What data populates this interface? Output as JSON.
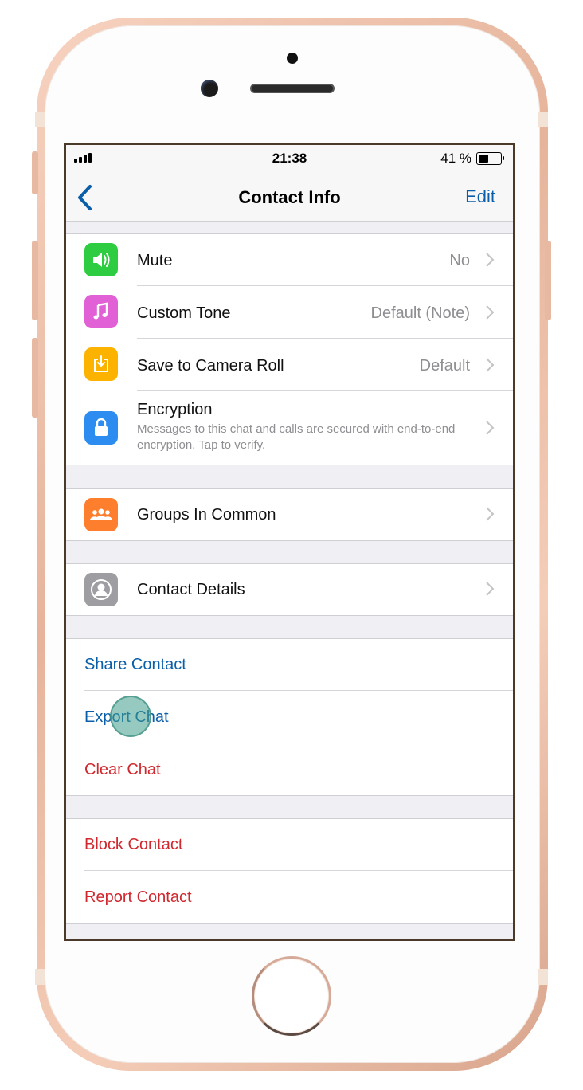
{
  "status_bar": {
    "time": "21:38",
    "battery_percent": "41 %",
    "battery_level": 0.41,
    "signal_bars": 4
  },
  "nav": {
    "back_icon": "chevron-left-icon",
    "title": "Contact Info",
    "edit_label": "Edit"
  },
  "settings": {
    "mute": {
      "label": "Mute",
      "value": "No",
      "icon": "speaker-icon",
      "color": "#2ecc40"
    },
    "custom_tone": {
      "label": "Custom Tone",
      "value": "Default (Note)",
      "icon": "music-note-icon",
      "color": "#e260d5"
    },
    "save_camera_roll": {
      "label": "Save to Camera Roll",
      "value": "Default",
      "icon": "download-icon",
      "color": "#fcb300"
    },
    "encryption": {
      "label": "Encryption",
      "description": "Messages to this chat and calls are secured with end-to-end encryption. Tap to verify.",
      "icon": "lock-icon",
      "color": "#2d8cf0"
    }
  },
  "groups_in_common": {
    "label": "Groups In Common",
    "icon": "group-icon",
    "color": "#fd7e2c"
  },
  "contact_details": {
    "label": "Contact Details",
    "icon": "contact-icon",
    "color": "#9e9ea2"
  },
  "actions": {
    "share_contact": "Share Contact",
    "export_chat": "Export Chat",
    "clear_chat": "Clear Chat"
  },
  "danger_actions": {
    "block_contact": "Block Contact",
    "report_contact": "Report Contact"
  },
  "colors": {
    "link_blue": "#0b5ea8",
    "destructive_red": "#d0282e",
    "screen_background": "#efeff4"
  }
}
